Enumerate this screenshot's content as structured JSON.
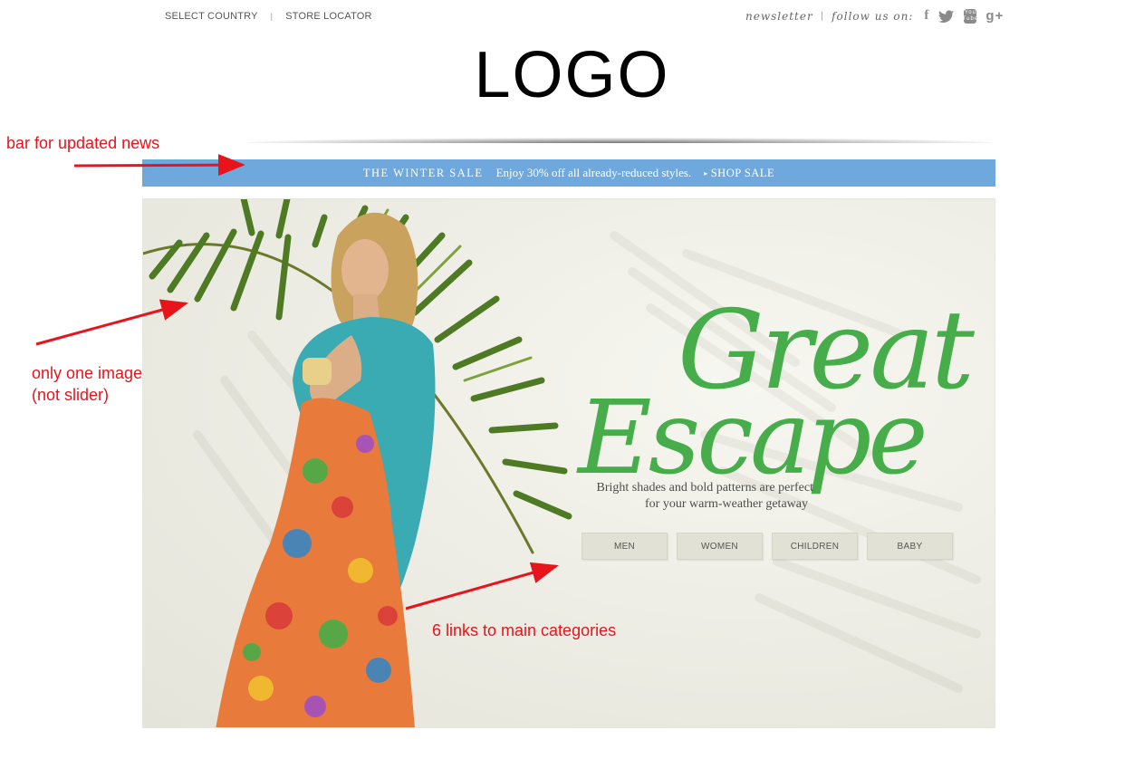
{
  "utility": {
    "select_country": "SELECT COUNTRY",
    "separator": "|",
    "store_locator": "STORE LOCATOR",
    "newsletter": "newsletter",
    "follow_us": "follow us on:",
    "social_icons": [
      "facebook-icon",
      "twitter-icon",
      "youtube-icon",
      "google-plus-icon"
    ],
    "facebook_glyph": "f",
    "youtube_glyph_top": "You",
    "youtube_glyph_bottom": "Tube",
    "googleplus_glyph": "g+"
  },
  "logo": "LOGO",
  "newsbar": {
    "title": "THE WINTER SALE",
    "text": "Enjoy 30% off all already-reduced styles.",
    "link": "SHOP SALE",
    "color": "#6fa8dc"
  },
  "hero": {
    "headline_line1": "Great",
    "headline_line2": "Escape",
    "subcopy_line1": "Bright shades and bold patterns are perfect",
    "subcopy_line2": "for your warm-weather getaway",
    "headline_color": "#46ad4a",
    "categories": [
      "MEN",
      "WOMEN",
      "CHILDREN",
      "BABY"
    ]
  },
  "annotations": {
    "news_bar": "bar for updated news",
    "image_line1": "only one image",
    "image_line2": "(not slider)",
    "categories": "6 links to main categories",
    "color": "#e8141c"
  }
}
